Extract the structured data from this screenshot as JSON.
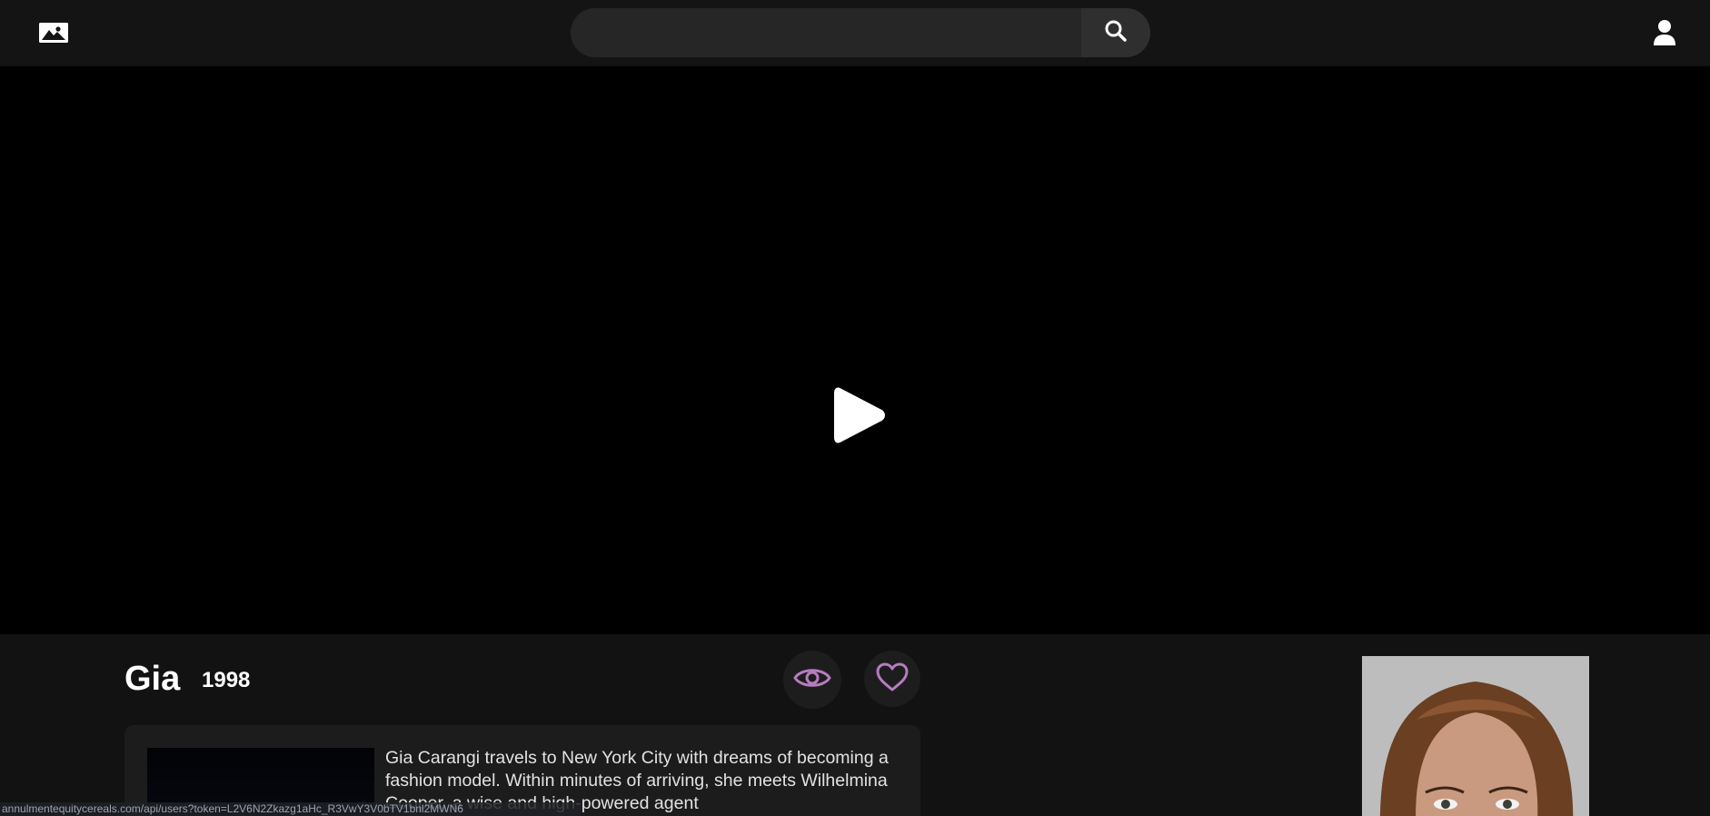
{
  "header": {
    "logo_icon": "image-icon",
    "search": {
      "placeholder": "",
      "value": "",
      "button_icon": "search-icon"
    },
    "account_icon": "user-icon"
  },
  "player": {
    "play_icon": "play-icon"
  },
  "movie": {
    "title": "Gia",
    "year": "1998",
    "description": "Gia Carangi travels to New York City with dreams of becoming a fashion model. Within minutes of arriving, she meets Wilhelmina Cooper, a wise and high-powered agent",
    "watch_icon": "eye-icon",
    "favorite_icon": "heart-icon"
  },
  "status_bar": {
    "url": "annulmentequitycereals.com/api/users?token=L2V6N2Zkazg1aHc_R3VwY3V0bTV1bnl2MWN6"
  },
  "colors": {
    "accent": "#b67cc0",
    "background": "#121212",
    "header": "#141414"
  }
}
